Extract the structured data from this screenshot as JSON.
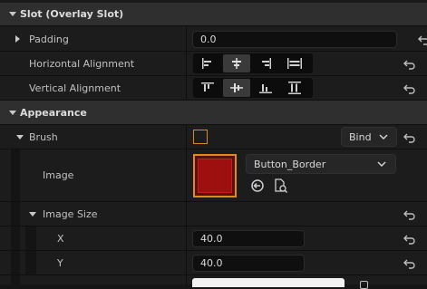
{
  "sections": {
    "slot": {
      "title": "Slot (Overlay Slot)"
    },
    "appearance": {
      "title": "Appearance"
    }
  },
  "padding": {
    "label": "Padding",
    "value": "0.0"
  },
  "horizontal_alignment": {
    "label": "Horizontal Alignment",
    "options": [
      "fill-left",
      "center",
      "right",
      "fill"
    ],
    "selected": 1
  },
  "vertical_alignment": {
    "label": "Vertical Alignment",
    "options": [
      "top",
      "center",
      "bottom",
      "fill"
    ],
    "selected": 1
  },
  "brush": {
    "label": "Brush",
    "bind_label": "Bind"
  },
  "image": {
    "label": "Image",
    "asset": "Button_Border",
    "thumb_color": "#9e1010"
  },
  "image_size": {
    "label": "Image Size",
    "x_label": "X",
    "x_value": "40.0",
    "y_label": "Y",
    "y_value": "40.0"
  },
  "icons": [
    "chevron-down-icon",
    "chevron-right-icon",
    "reset-arrow-icon",
    "use-selected-asset-icon",
    "browse-asset-icon"
  ],
  "colors": {
    "category_bg": "#2f2f2f",
    "panel_bg": "#1a1a1a",
    "input_bg": "#0f0f0f",
    "thumb_border": "#e08a1a"
  }
}
